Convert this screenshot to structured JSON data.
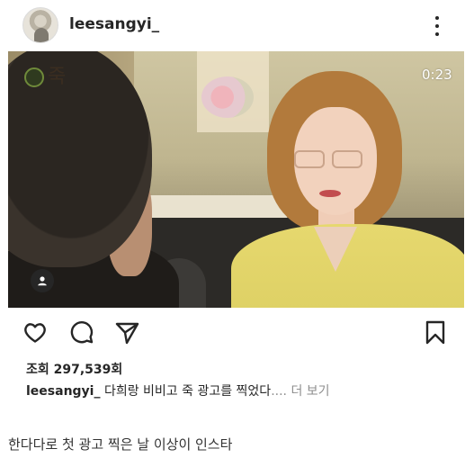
{
  "post": {
    "username": "leesangyi_",
    "video_timer": "0:23",
    "video_logo_text": "죽",
    "views_label": "조회",
    "views_count": "297,539회",
    "caption_username": "leesangyi_",
    "caption_text": "다희랑 비비고 죽 광고를 찍었다",
    "caption_ellipsis": "....",
    "caption_more": "더 보기"
  },
  "comment": {
    "text": "한다다로 첫 광고 찍은 날 이상이 인스타"
  },
  "icons": {
    "more": "more-vertical-icon",
    "like": "heart-icon",
    "comment": "comment-icon",
    "share": "send-icon",
    "save": "bookmark-icon",
    "tag": "user-tag-icon"
  },
  "colors": {
    "text": "#262626",
    "muted": "#8e8e8e",
    "background": "#ffffff"
  }
}
